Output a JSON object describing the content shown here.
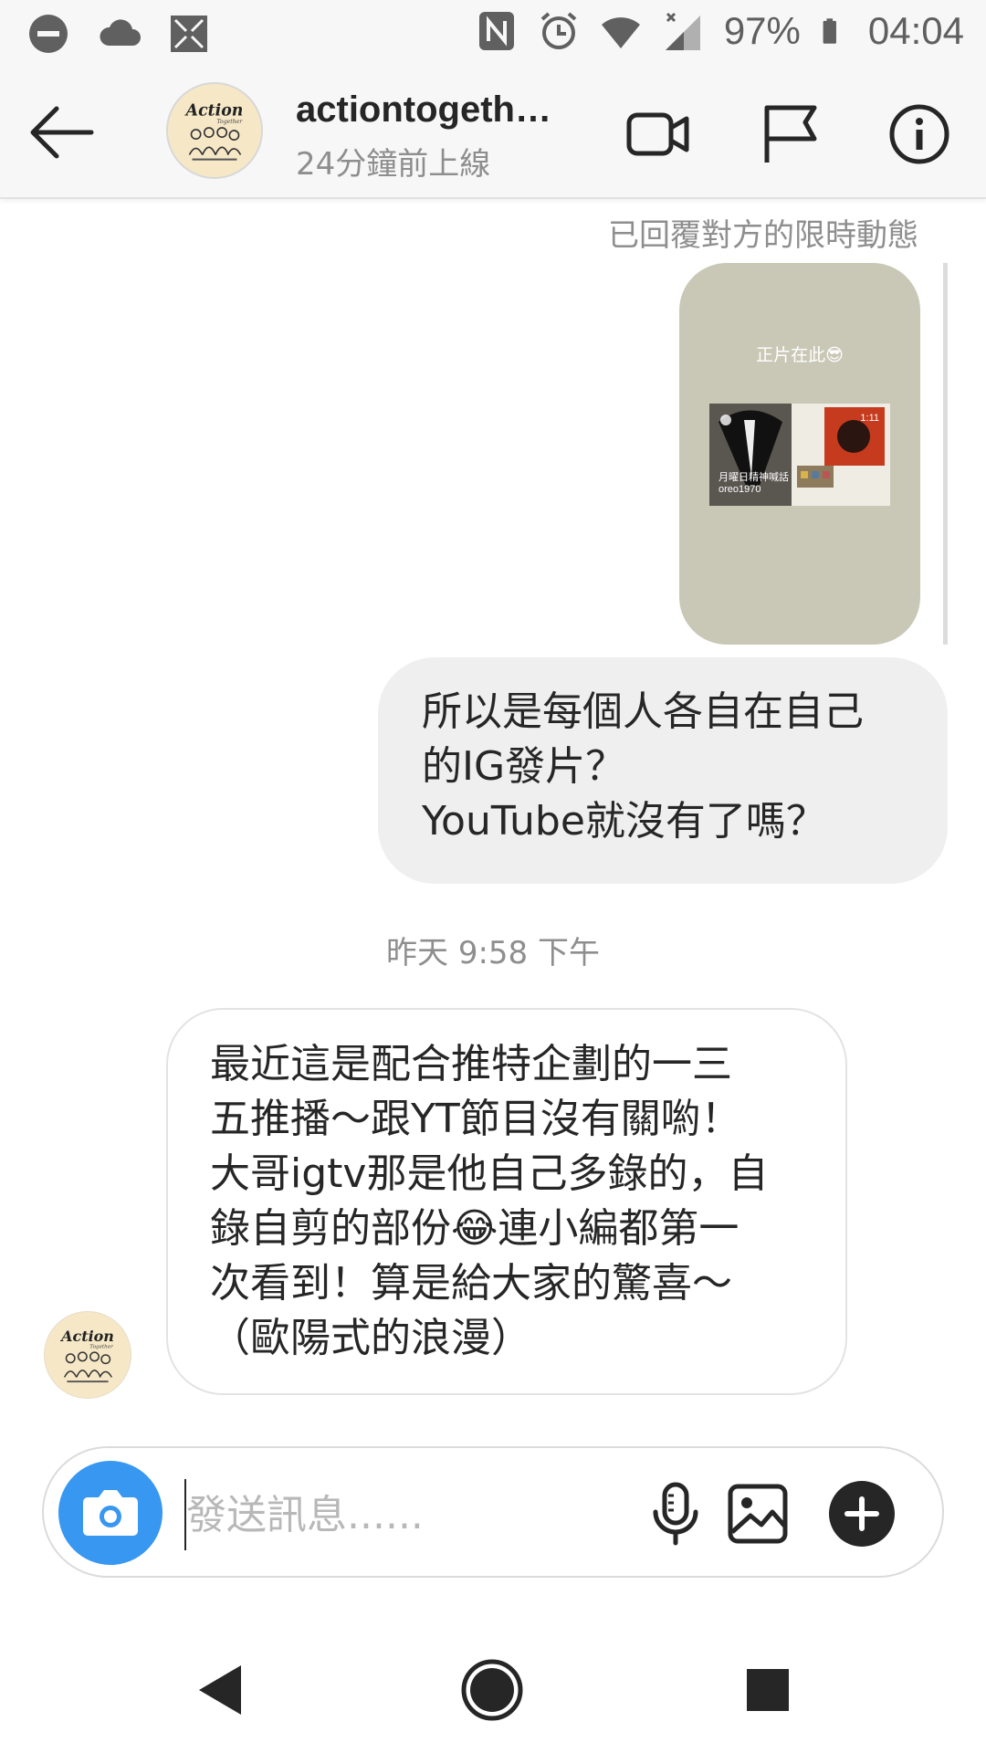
{
  "status_bar": {
    "battery": "97%",
    "time": "04:04",
    "icons": [
      "do-not-disturb-icon",
      "cloud-icon",
      "app-icon",
      "nfc-icon",
      "alarm-icon",
      "wifi-icon",
      "signal-icon",
      "battery-icon"
    ]
  },
  "header": {
    "title": "actiontogeth…",
    "subtitle": "24分鐘前上線",
    "icons": [
      "back-arrow-icon",
      "video-call-icon",
      "flag-icon",
      "info-icon"
    ]
  },
  "chat": {
    "reply_note": "已回覆對方的限時動態",
    "story": {
      "caption": "正片在此😎",
      "thumb_title": "月曜日精神喊話",
      "thumb_user": "oreo1970",
      "thumb_duration": "1:11"
    },
    "outgoing": {
      "lines": [
        "所以是每個人各自在自己",
        "的IG發片？",
        "YouTube就沒有了嗎？"
      ]
    },
    "timestamp": "昨天 9:58 下午",
    "incoming": {
      "lines": [
        "最近這是配合推特企劃的一三",
        "五推播～跟YT節目沒有關喲！",
        "大哥igtv那是他自己多錄的，自",
        "錄自剪的部份😂連小編都第一",
        "次看到！算是給大家的驚喜～",
        "（歐陽式的浪漫）"
      ]
    }
  },
  "avatar": {
    "logo_text": "Action",
    "logo_subtext": "Together"
  },
  "composer": {
    "placeholder": "發送訊息......",
    "value": "",
    "icons": [
      "camera-icon",
      "microphone-icon",
      "gallery-icon",
      "plus-icon"
    ]
  },
  "colors": {
    "accent": "#3897f0",
    "bubble_out": "#efefef",
    "story_bg": "#c9c8b6",
    "muted_text": "#8e8e8e"
  }
}
